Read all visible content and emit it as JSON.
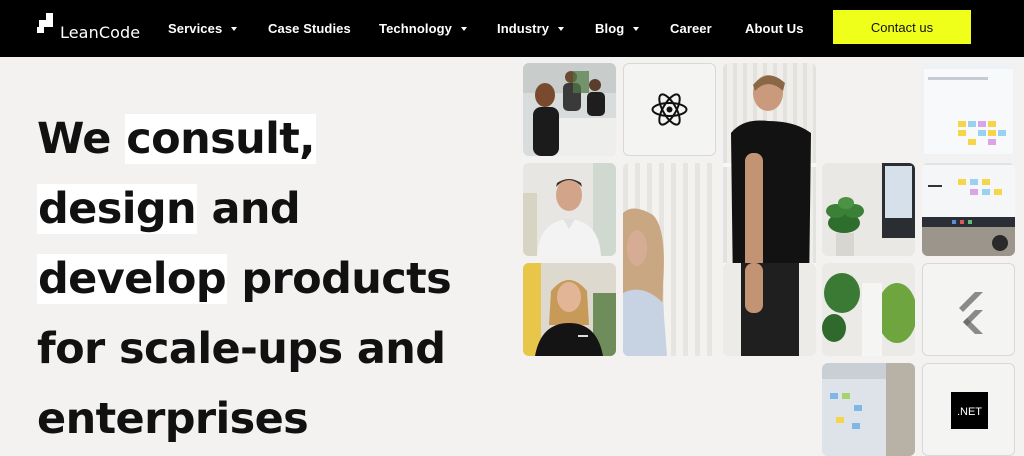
{
  "nav": {
    "brand": "LeanCode",
    "items": [
      {
        "label": "Services",
        "dropdown": true
      },
      {
        "label": "Case Studies",
        "dropdown": false
      },
      {
        "label": "Technology",
        "dropdown": true
      },
      {
        "label": "Industry",
        "dropdown": true
      },
      {
        "label": "Blog",
        "dropdown": true
      },
      {
        "label": "Career",
        "dropdown": false
      },
      {
        "label": "About Us",
        "dropdown": false
      }
    ],
    "cta_label": "Contact us"
  },
  "hero": {
    "line1_pre": "We ",
    "line1_hl": "consult,",
    "line2_hl": "design",
    "line2_post": " and",
    "line3_hl": "develop",
    "line3_post": " products",
    "line4": "for scale-ups and",
    "line5": "enterprises"
  },
  "tiles": {
    "dotnet_label": ".NET"
  },
  "colors": {
    "nav_bg": "#000000",
    "accent": "#f0ff1a",
    "page_bg": "#f3f2f0",
    "highlight": "#ffffff"
  },
  "icons": [
    "react-icon",
    "flutter-icon",
    "dotnet-icon",
    "caret-down-icon"
  ]
}
